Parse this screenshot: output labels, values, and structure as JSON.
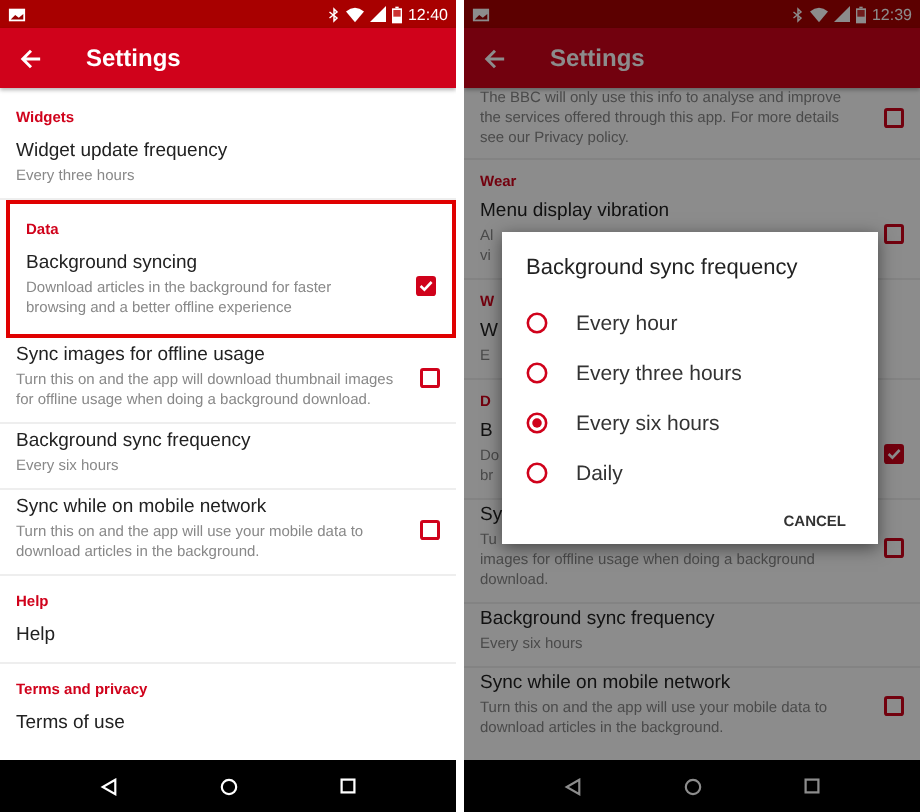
{
  "screens": [
    {
      "status_time": "12:40",
      "title": "Settings",
      "sections": [
        {
          "header": "Widgets",
          "rows": [
            {
              "kind": "pref",
              "title": "Widget update frequency",
              "summary": "Every three hours"
            }
          ]
        },
        {
          "header": "Data",
          "highlighted": true,
          "rows": [
            {
              "kind": "checkbox",
              "title": "Background syncing",
              "summary": "Download articles in the background for faster browsing and a better offline experience",
              "checked": true
            }
          ]
        },
        {
          "rows": [
            {
              "kind": "checkbox",
              "title": "Sync images for offline usage",
              "summary": "Turn this on and the app will download thumbnail images for offline usage when doing a background download.",
              "checked": false
            },
            {
              "kind": "pref",
              "title": "Background sync frequency",
              "summary": "Every six hours"
            },
            {
              "kind": "checkbox",
              "title": "Sync while on mobile network",
              "summary": "Turn this on and the app will use your mobile data to download articles in the background.",
              "checked": false
            }
          ]
        },
        {
          "header": "Help",
          "rows": [
            {
              "kind": "pref",
              "title": "Help"
            }
          ]
        },
        {
          "header": "Terms and privacy",
          "rows": [
            {
              "kind": "pref",
              "title": "Terms of use"
            }
          ]
        }
      ]
    },
    {
      "dimmed": true,
      "status_time": "12:39",
      "title": "Settings",
      "sections": [
        {
          "rows": [
            {
              "kind": "checkbox",
              "summary": "The BBC will only use this info to analyse and improve the services offered through this app. For more details see our Privacy policy.",
              "checked": false
            }
          ]
        },
        {
          "header": "Wear",
          "rows": [
            {
              "kind": "checkbox",
              "title": "Menu display vibration",
              "lines": [
                "Al",
                "vi"
              ],
              "checked": false
            }
          ]
        },
        {
          "header": "W",
          "rows": [
            {
              "kind": "pref",
              "title": "W",
              "lines": [
                "E"
              ]
            }
          ]
        },
        {
          "header": "D",
          "rows": [
            {
              "kind": "checkbox",
              "title": "B",
              "lines": [
                "Do",
                "br"
              ],
              "checked": true
            },
            {
              "kind": "checkbox",
              "title": "Sy",
              "lines": [
                "Tu",
                "images for offline usage when doing a background",
                "download."
              ],
              "checked": false
            },
            {
              "kind": "pref",
              "title": "Background sync frequency",
              "summary": "Every six hours"
            },
            {
              "kind": "checkbox",
              "title": "Sync while on mobile network",
              "summary": "Turn this on and the app will use your mobile data to download articles in the background.",
              "checked": false
            }
          ]
        }
      ],
      "dialog": {
        "title": "Background sync frequency",
        "options": [
          {
            "label": "Every hour",
            "selected": false
          },
          {
            "label": "Every three hours",
            "selected": false
          },
          {
            "label": "Every six hours",
            "selected": true
          },
          {
            "label": "Daily",
            "selected": false
          }
        ],
        "button": "CANCEL"
      }
    }
  ]
}
